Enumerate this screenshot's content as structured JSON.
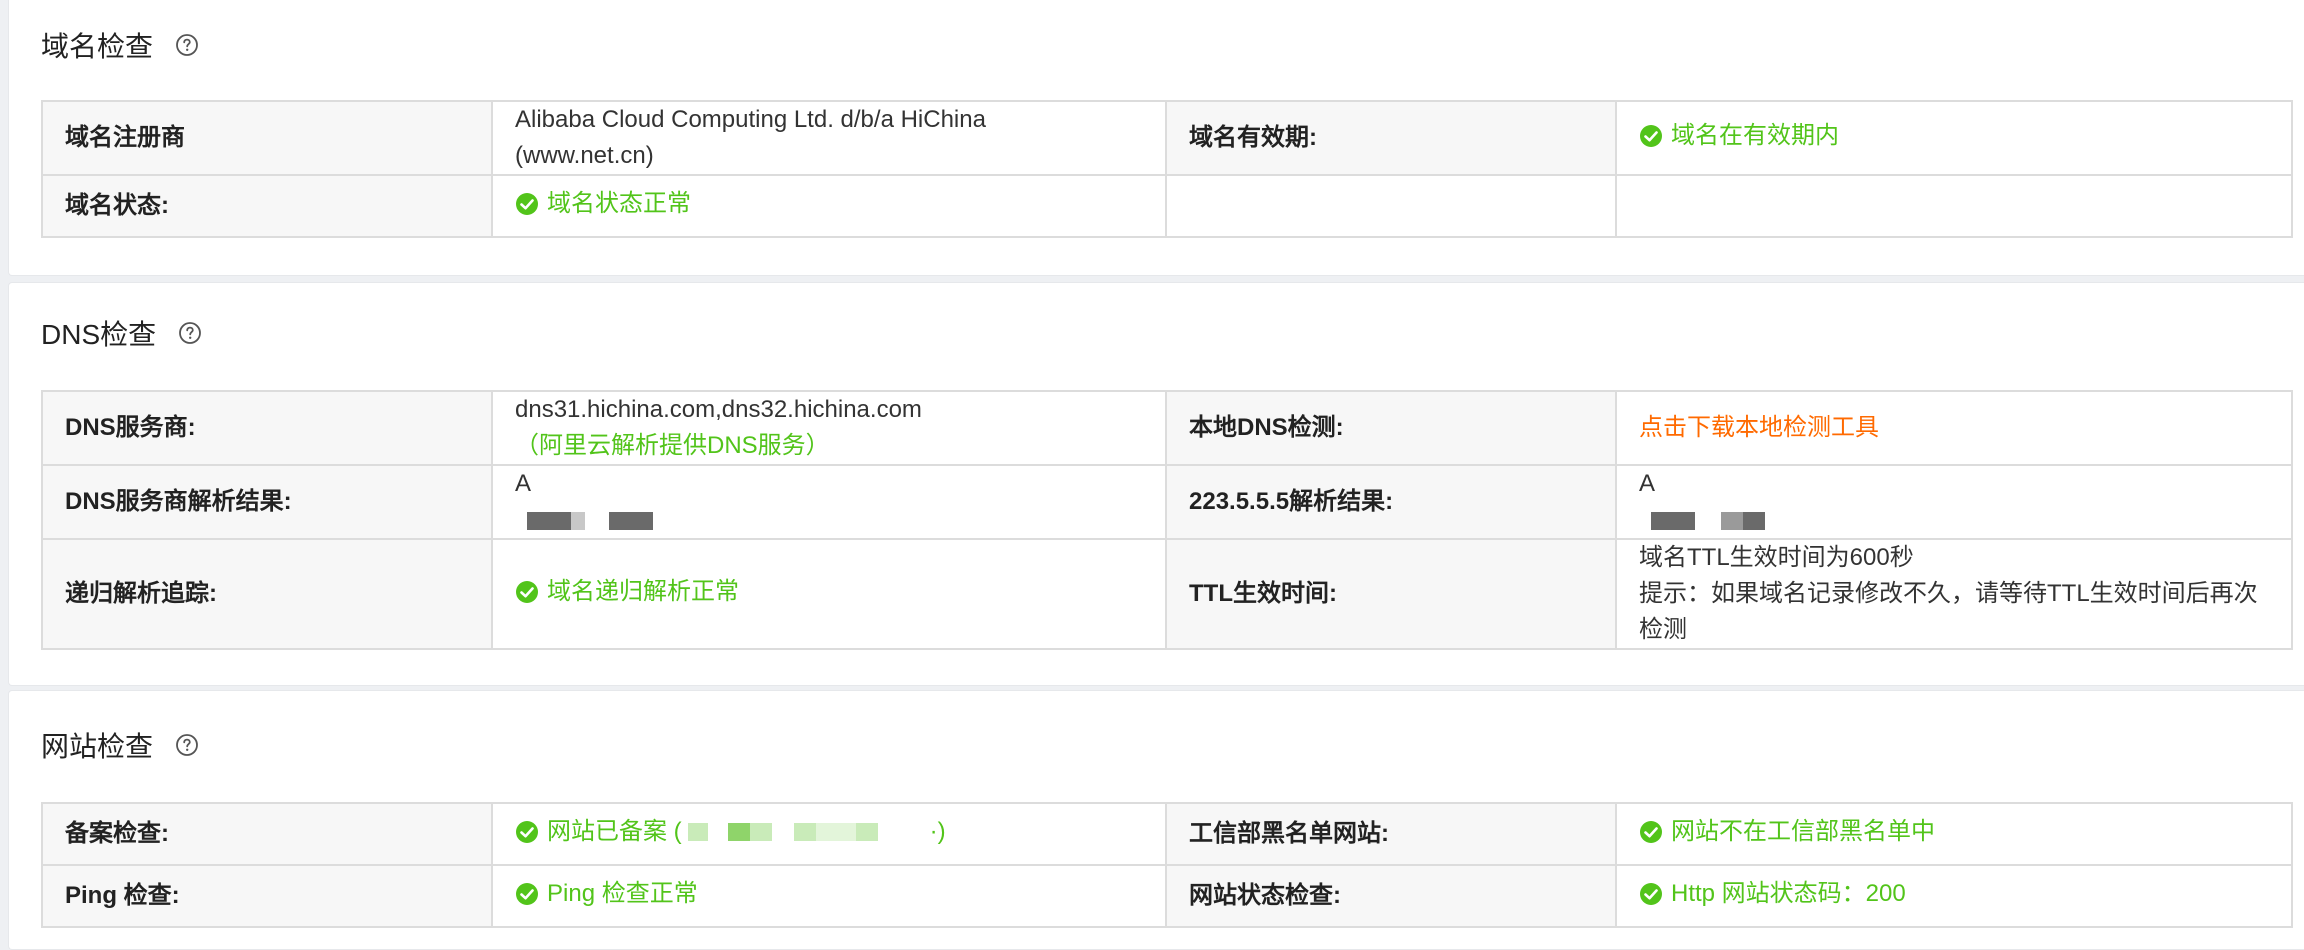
{
  "domain_check": {
    "title": "域名检查",
    "registrar_label": "域名注册商",
    "registrar_value_line1": "Alibaba Cloud Computing Ltd. d/b/a HiChina",
    "registrar_value_line2": "(www.net.cn)",
    "validity_label": "域名有效期:",
    "validity_value": "域名在有效期内",
    "status_label": "域名状态:",
    "status_value": "域名状态正常"
  },
  "dns_check": {
    "title": "DNS检查",
    "provider_label": "DNS服务商:",
    "provider_value_line1": "dns31.hichina.com,dns32.hichina.com",
    "provider_value_line2": "（阿里云解析提供DNS服务）",
    "local_label": "本地DNS检测:",
    "local_value": "点击下载本地检测工具",
    "provider_result_label": "DNS服务商解析结果:",
    "provider_result_type": "A",
    "ali_result_label": "223.5.5.5解析结果:",
    "ali_result_type": "A",
    "recursive_label": "递归解析追踪:",
    "recursive_value": "域名递归解析正常",
    "ttl_label": "TTL生效时间:",
    "ttl_value_line1": "域名TTL生效时间为600秒",
    "ttl_value_line2": "提示：如果域名记录修改不久，请等待TTL生效时间后再次",
    "ttl_value_line3": "检测"
  },
  "site_check": {
    "title": "网站检查",
    "icp_label": "备案检查:",
    "icp_value_prefix": "网站已备案 (",
    "icp_value_suffix": "·)",
    "blacklist_label": "工信部黑名单网站:",
    "blacklist_value": "网站不在工信部黑名单中",
    "ping_label": "Ping 检查:",
    "ping_value": "Ping 检查正常",
    "http_label": "网站状态检查:",
    "http_value": "Http 网站状态码：200"
  },
  "colors": {
    "success": "#52c41a",
    "link_orange": "#ff6a00",
    "label_bg": "#f7f7f7",
    "border": "#dcdcdc"
  },
  "icons": {
    "help": "question-circle-icon",
    "ok": "check-circle-icon"
  }
}
